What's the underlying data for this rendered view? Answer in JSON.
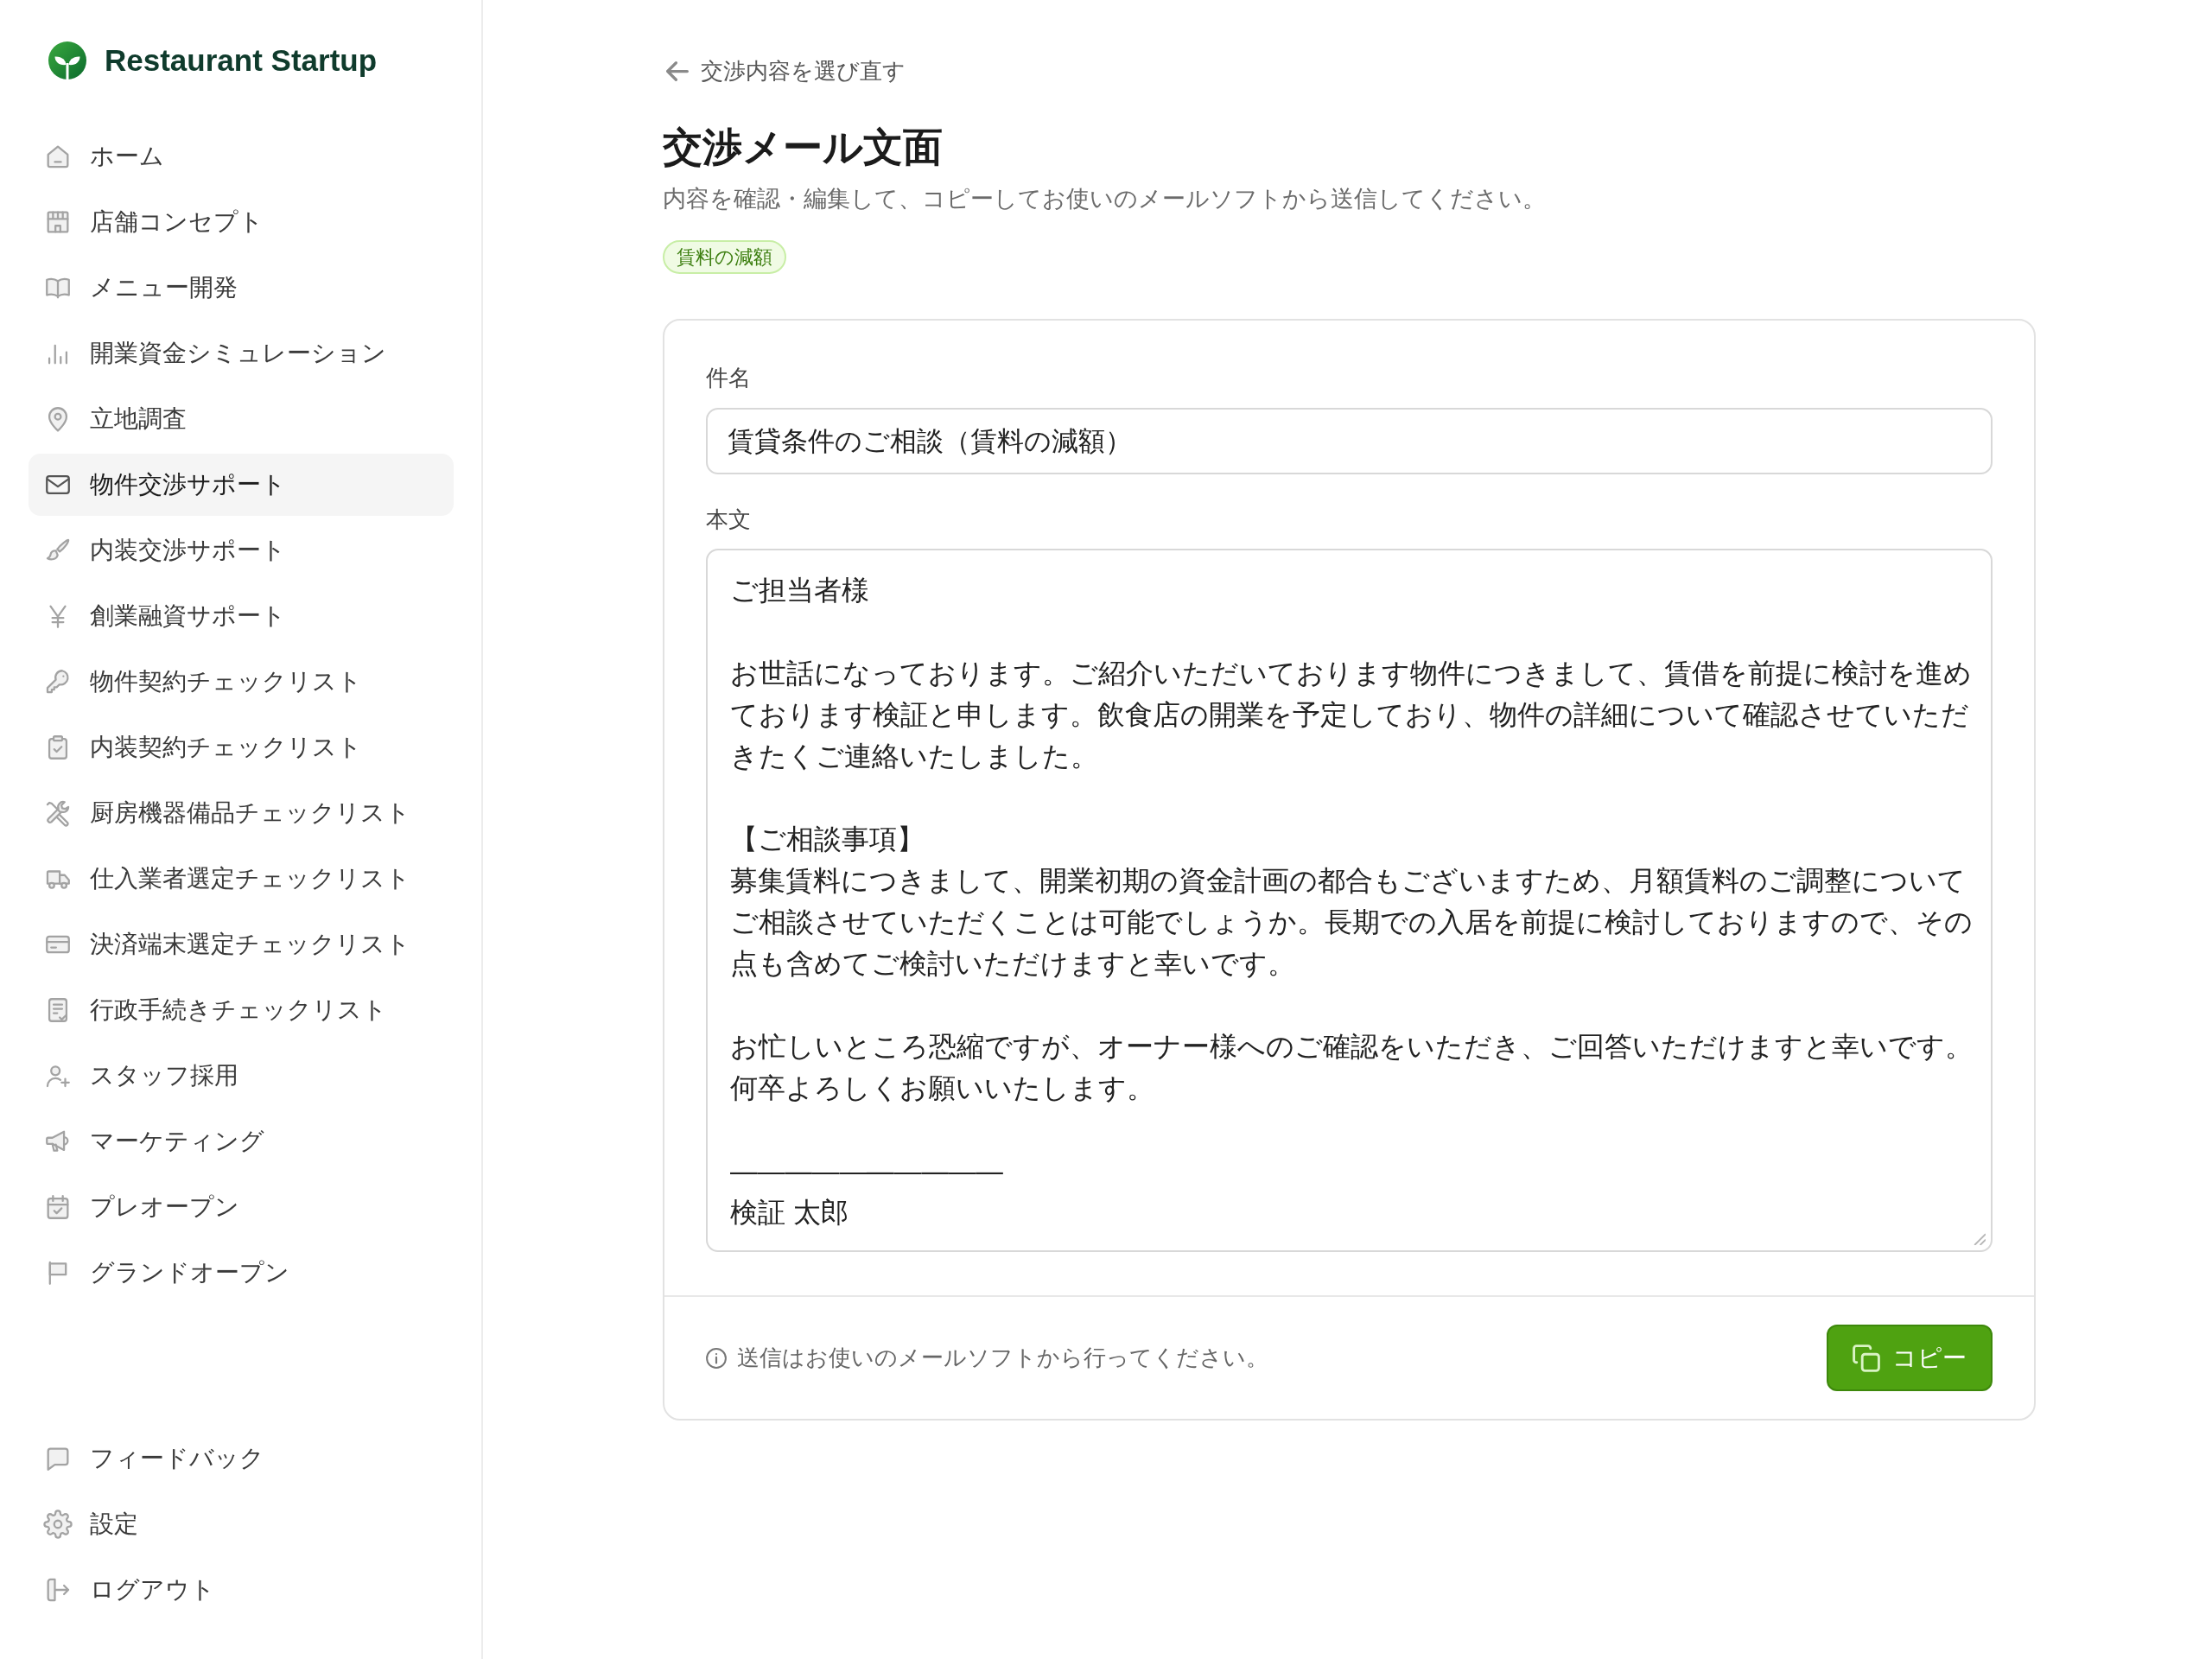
{
  "sidebar": {
    "brand": "Restaurant Startup",
    "items": [
      {
        "label": "ホーム",
        "selected": false
      },
      {
        "label": "店舗コンセプト",
        "selected": false
      },
      {
        "label": "メニュー開発",
        "selected": false
      },
      {
        "label": "開業資金シミュレーション",
        "selected": false
      },
      {
        "label": "立地調査",
        "selected": false
      },
      {
        "label": "物件交渉サポート",
        "selected": true
      },
      {
        "label": "内装交渉サポート",
        "selected": false
      },
      {
        "label": "創業融資サポート",
        "selected": false
      },
      {
        "label": "物件契約チェックリスト",
        "selected": false
      },
      {
        "label": "内装契約チェックリスト",
        "selected": false
      },
      {
        "label": "厨房機器備品チェックリスト",
        "selected": false
      },
      {
        "label": "仕入業者選定チェックリスト",
        "selected": false
      },
      {
        "label": "決済端末選定チェックリスト",
        "selected": false
      },
      {
        "label": "行政手続きチェックリスト",
        "selected": false
      },
      {
        "label": "スタッフ採用",
        "selected": false
      },
      {
        "label": "マーケティング",
        "selected": false
      },
      {
        "label": "プレオープン",
        "selected": false
      },
      {
        "label": "グランドオープン",
        "selected": false
      }
    ],
    "footer_items": [
      {
        "label": "フィードバック",
        "selected": false
      },
      {
        "label": "設定",
        "selected": false
      },
      {
        "label": "ログアウト",
        "selected": false
      }
    ]
  },
  "main": {
    "back_link": "交渉内容を選び直す",
    "title": "交渉メール文面",
    "subtitle": "内容を確認・編集して、コピーしてお使いのメールソフトから送信してください。",
    "tag": "賃料の減額",
    "form": {
      "subject": {
        "label": "件名",
        "value": "賃貸条件のご相談（賃料の減額）"
      },
      "body": {
        "label": "本文",
        "paragraphs": [
          [
            "ご担当者様"
          ],
          [
            "お世話になっております。ご紹介いただいております物件につきまして、賃借を前提に検討を進めております検証と申します。飲食店の開業を予定しており、物件の詳細について確認させていただきたくご連絡いたしました。"
          ],
          [
            "【ご相談事項】",
            "募集賃料につきまして、開業初期の資金計画の都合もございますため、月額賃料のご調整についてご相談させていただくことは可能でしょうか。長期での入居を前提に検討しておりますので、その点も含めてご検討いただけますと幸いです。"
          ],
          [
            "お忙しいところ恐縮ですが、オーナー様へのご確認をいただき、ご回答いただけますと幸いです。何卒よろしくお願いいたします。"
          ],
          [
            "——————————",
            "検証 太郎"
          ]
        ]
      }
    },
    "footer": {
      "note": "送信はお使いのメールソフトから行ってください。",
      "copy_button": "コピー"
    }
  }
}
